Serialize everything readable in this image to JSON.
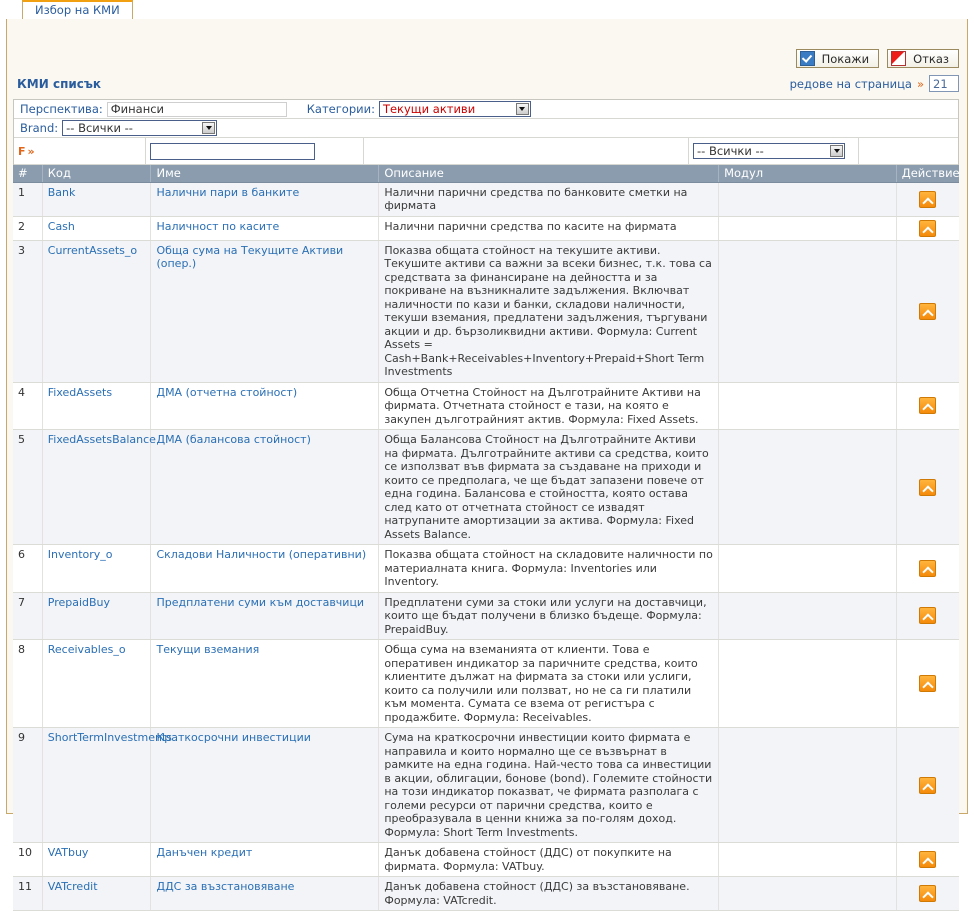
{
  "tab": {
    "label": "Избор на КМИ"
  },
  "toolbar": {
    "show_label": "Покажи",
    "cancel_label": "Отказ",
    "show_icon": "checkbox-checked-icon",
    "cancel_icon": "red-triangle-icon"
  },
  "header": {
    "list_title": "КМИ списък",
    "rows_per_page_label": "редове на страница",
    "rows_per_page_arrow": "»",
    "rows_per_page_value": "21"
  },
  "filters": {
    "perspective_label": "Перспектива:",
    "perspective_value": "Финанси",
    "category_label": "Категории:",
    "category_value": "Текущи активи",
    "brand_label": "Brand:",
    "brand_value": "-- Всички --",
    "filter_marker": "F",
    "filter_marker_arrow": "»",
    "name_search_value": "",
    "module_filter_value": "-- Всички --"
  },
  "table": {
    "columns": {
      "num": "#",
      "code": "Код",
      "name": "Име",
      "description": "Описание",
      "module": "Модул",
      "action": "Действие"
    },
    "rows": [
      {
        "num": "1",
        "code": "Bank",
        "name": "Налични пари в банките",
        "description": "Налични парични средства по банковите сметки на фирмата",
        "module": "",
        "action_icon": "expand-up-icon"
      },
      {
        "num": "2",
        "code": "Cash",
        "name": "Наличност по касите",
        "description": "Налични парични средства по касите на фирмата",
        "module": "",
        "action_icon": "expand-up-icon"
      },
      {
        "num": "3",
        "code": "CurrentAssets_o",
        "name": "Обща сума на Текущите Активи (опер.)",
        "description": "Показва общата стойност на текушите активи. Текушите активи са важни за всеки бизнес, т.к. това са средствата за финансиране на дейността и за покриване на възникналите задължения. Включват наличности по кази и банки, складови наличности, текуши вземания, предлатени задължения, търгувани акции и др. бързоликвидни активи. Формула: Current Assets = Cash+Bank+Receivables+Inventory+Prepaid+Short Term Investments",
        "module": "",
        "action_icon": "expand-up-icon"
      },
      {
        "num": "4",
        "code": "FixedAssets",
        "name": "ДМА (отчетна стойност)",
        "description": "Обща Отчетна Стойност на Дълготрайните Активи на фирмата. Отчетната стойност е тази, на която е закупен дълготрайният актив. Формула: Fixed Assets.",
        "module": "",
        "action_icon": "expand-up-icon"
      },
      {
        "num": "5",
        "code": "FixedAssetsBalance",
        "name": "ДМА (балансова стойност)",
        "description": "Обща Балансова Стойност на Дълготрайните Активи на фирмата. Дълготрайните активи са средства, които се използват във фирмата за създаване на приходи и които се предполага, че ще бъдат запазени повече от една година. Балансова е стойността, която остава след като от отчетната стойност се извадят натрупаните амортизации за актива. Формула: Fixed Assets Balance.",
        "module": "",
        "action_icon": "expand-up-icon"
      },
      {
        "num": "6",
        "code": "Inventory_o",
        "name": "Складови Наличности (оперативни)",
        "description": "Показва общата стойност на складовите наличности по материалната книга. Формула: Inventories или Inventory.",
        "module": "",
        "action_icon": "expand-up-icon"
      },
      {
        "num": "7",
        "code": "PrepaidBuy",
        "name": "Предплатени суми към доставчици",
        "description": "Предплатени суми за стоки или услуги на доставчици, които ще бъдат получени в близко бъдеще. Формула: PrepaidBuy.",
        "module": "",
        "action_icon": "expand-up-icon"
      },
      {
        "num": "8",
        "code": "Receivables_o",
        "name": "Текущи вземания",
        "description": "Обща сума на вземанията от клиенти. Това е оперативен индикатор за паричните средства, които клиентите дължат на фирмата за стоки или услиги, които са получили или ползват, но не са ги платили към момента. Сумата се взема от регистъра с продажбите. Формула: Receivables.",
        "module": "",
        "action_icon": "expand-up-icon"
      },
      {
        "num": "9",
        "code": "ShortTermInvestments",
        "name": "Краткосрочни инвестиции",
        "description": "Сума на краткосрочни инвестиции които фирмата е направила и които нормално ще се възвърнат в рамките на една година. Най-често това са инвестиции в акции, облигации, бонове (bond). Големите стойности на този индикатор показват, че фирмата разполага с големи ресурси от парични средства, които е преобразувала в ценни книжа за по-голям доход. Формула: Short Term Investments.",
        "module": "",
        "action_icon": "expand-up-icon"
      },
      {
        "num": "10",
        "code": "VATbuy",
        "name": "Данъчен кредит",
        "description": "Данък добавена стойност (ДДС) от покупките на фирмата. Формула: VATbuy.",
        "module": "",
        "action_icon": "expand-up-icon"
      },
      {
        "num": "11",
        "code": "VATcredit",
        "name": "ДДС за възстановяване",
        "description": "Данък добавена стойност (ДДС) за възстановяване. Формула: VATcredit.",
        "module": "",
        "action_icon": "expand-up-icon"
      }
    ]
  },
  "colors": {
    "tab_accent": "#f0a010",
    "frame_border": "#c8a96a",
    "link": "#2a6fb5",
    "header_bg": "#8b9cae",
    "action_orange": "#f58a0b",
    "filter_red": "#cc0000"
  }
}
